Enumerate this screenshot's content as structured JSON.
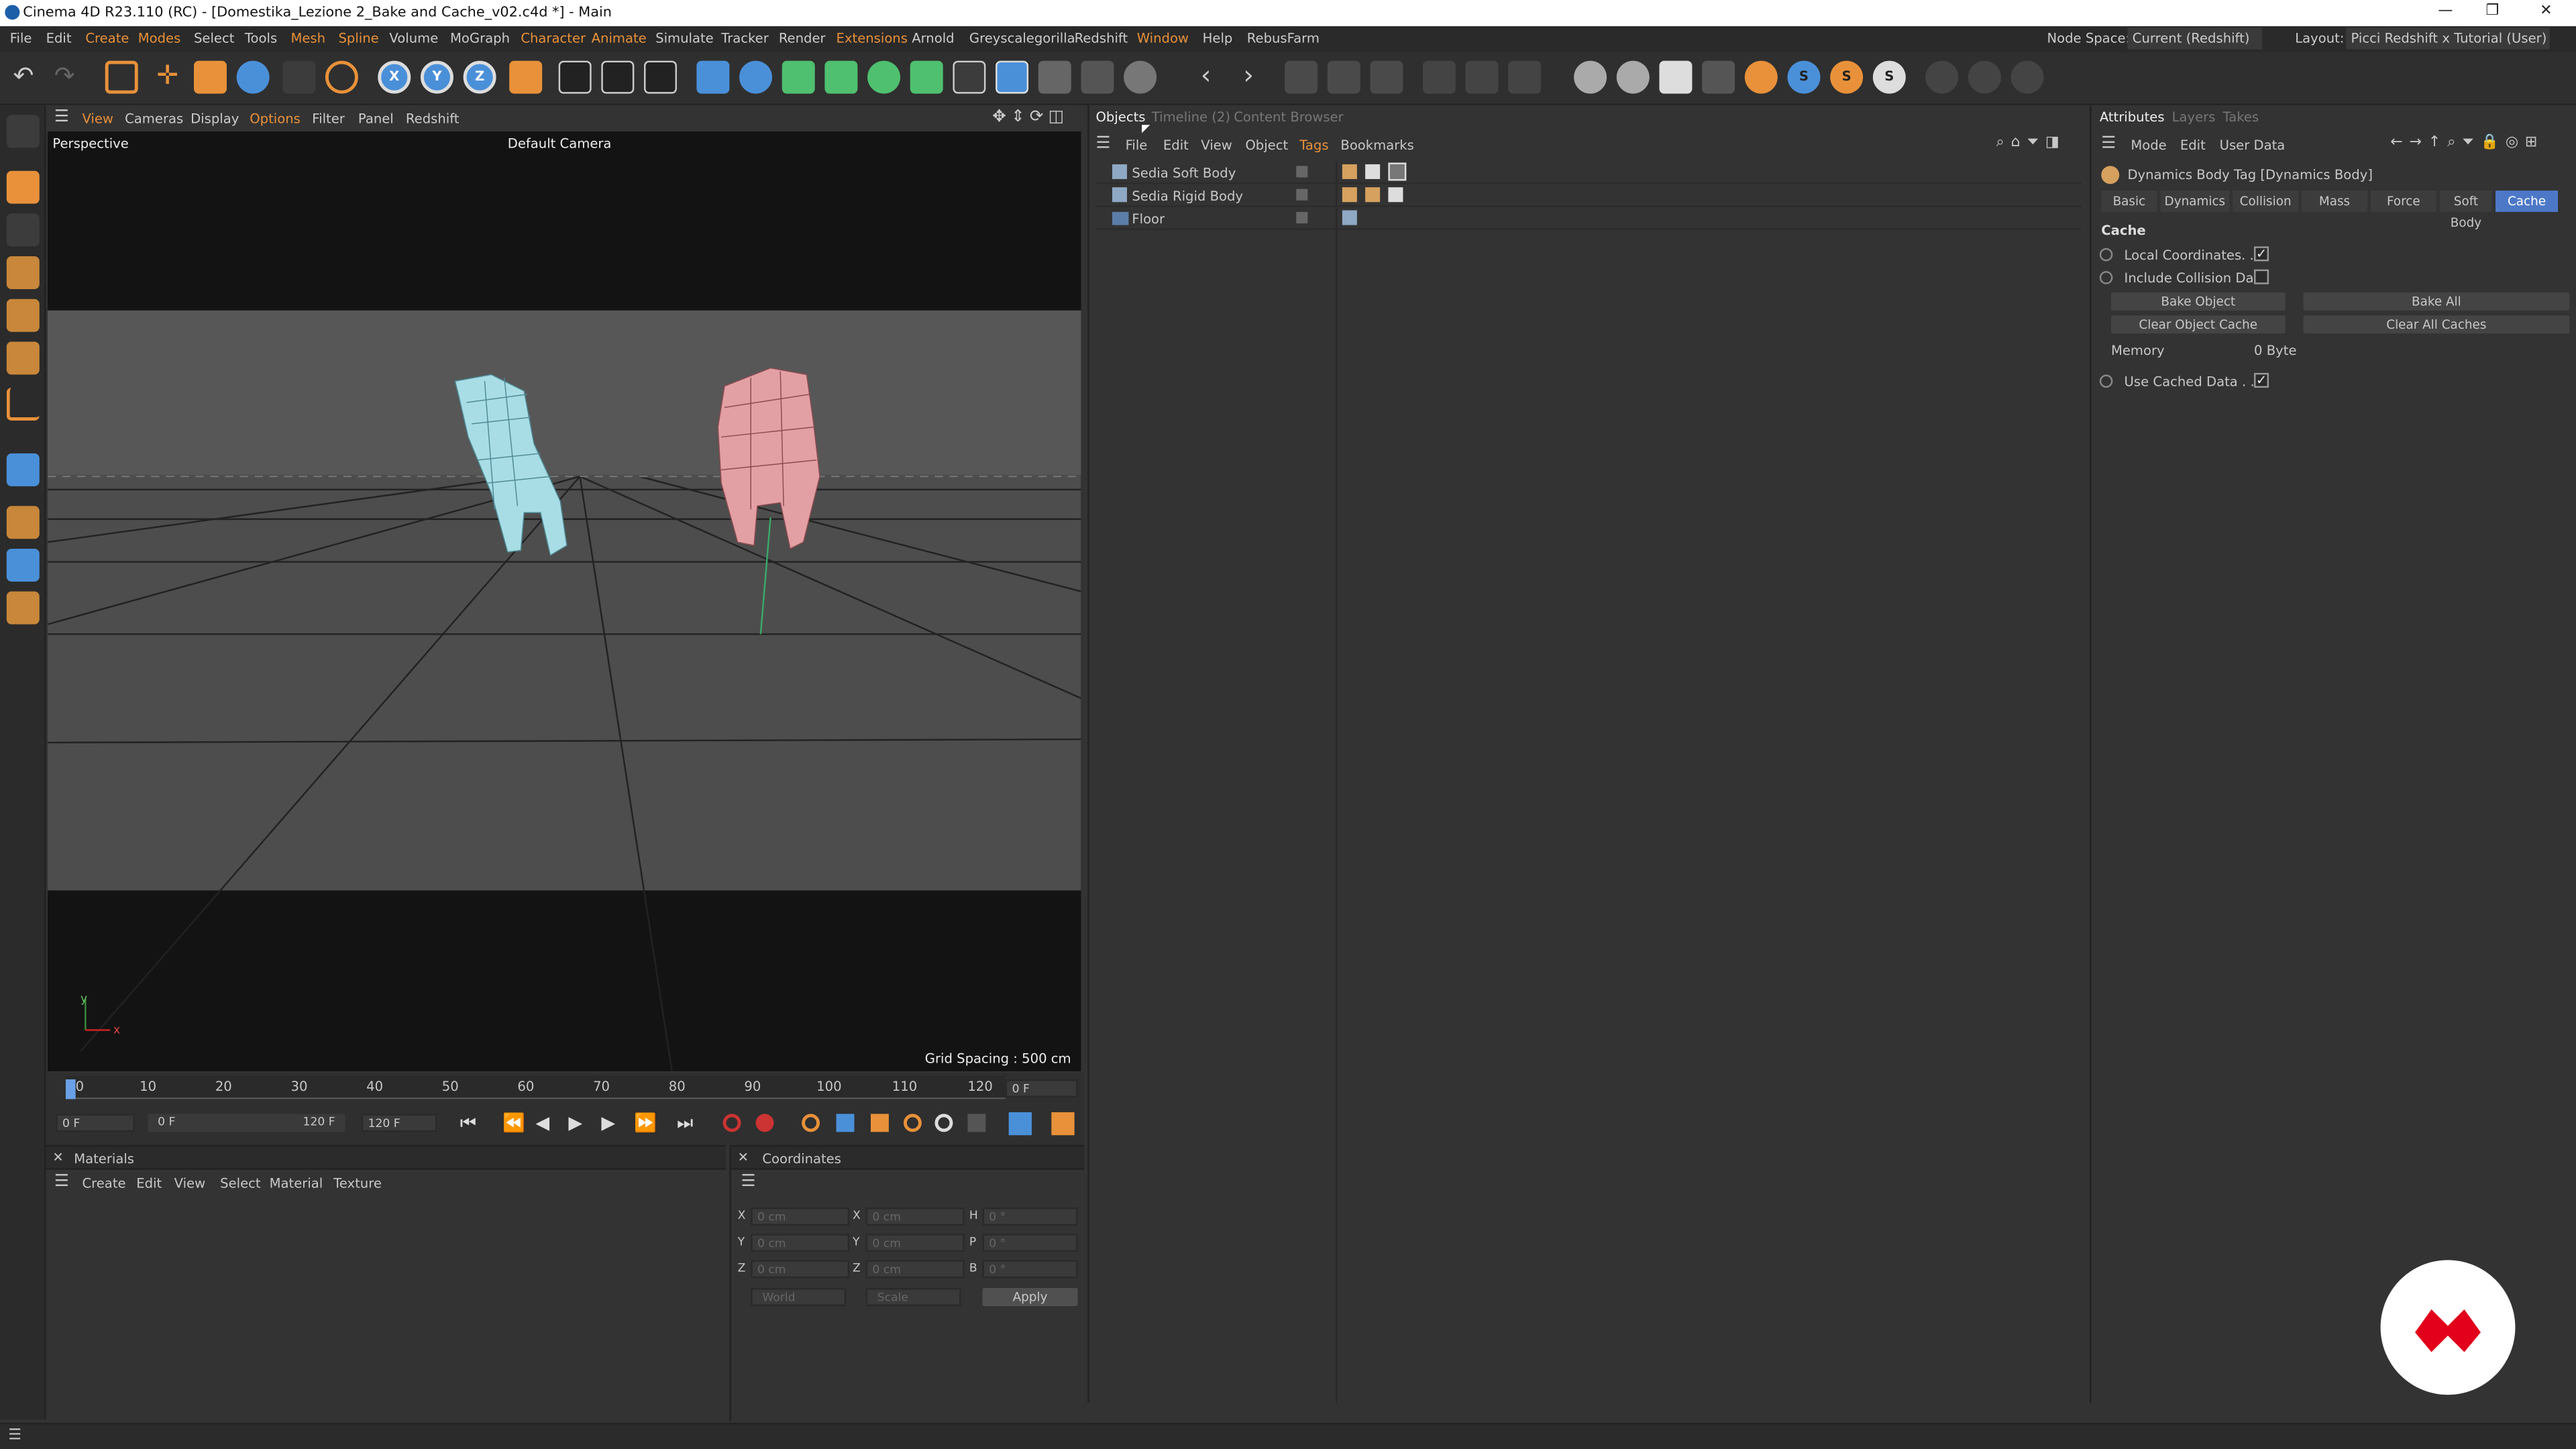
{
  "window": {
    "title": "Cinema 4D R23.110 (RC) - [Domestika_Lezione 2_Bake and Cache_v02.c4d *] - Main",
    "min": "—",
    "max": "❐",
    "close": "✕"
  },
  "menu": [
    "File",
    "Edit",
    "Create",
    "Modes",
    "Select",
    "Tools",
    "Mesh",
    "Spline",
    "Volume",
    "MoGraph",
    "Character",
    "Animate",
    "Simulate",
    "Tracker",
    "Render",
    "Extensions",
    "Arnold",
    "Greyscalegorilla",
    "Redshift",
    "Window",
    "Help",
    "RebusFarm"
  ],
  "node_space": {
    "label": "Node Space:",
    "value": "Current (Redshift)"
  },
  "layout": {
    "label": "Layout:",
    "value": "Picci Redshift x Tutorial (User)"
  },
  "viewport": {
    "menu": [
      "View",
      "Cameras",
      "Display",
      "Options",
      "Filter",
      "Panel",
      "Redshift"
    ],
    "view_name": "Perspective",
    "camera": "Default Camera",
    "grid_spacing": "Grid Spacing : 500 cm",
    "axis_x": "x",
    "axis_y": "y"
  },
  "timeline": {
    "ticks": [
      "0",
      "10",
      "20",
      "30",
      "40",
      "50",
      "60",
      "70",
      "80",
      "90",
      "100",
      "110",
      "120"
    ],
    "current_frame": "0 F",
    "start": "0 F",
    "range_start": "0 F",
    "range_end": "120 F",
    "end": "120 F"
  },
  "materials": {
    "title": "Materials",
    "menu": [
      "Create",
      "Edit",
      "View",
      "Select",
      "Material",
      "Texture"
    ]
  },
  "coordinates": {
    "title": "Coordinates",
    "rows": [
      {
        "a": "X",
        "av": "0 cm",
        "b": "X",
        "bv": "0 cm",
        "c": "H",
        "cv": "0 °"
      },
      {
        "a": "Y",
        "av": "0 cm",
        "b": "Y",
        "bv": "0 cm",
        "c": "P",
        "cv": "0 °"
      },
      {
        "a": "Z",
        "av": "0 cm",
        "b": "Z",
        "bv": "0 cm",
        "c": "B",
        "cv": "0 °"
      }
    ],
    "world": "World",
    "scale": "Scale",
    "apply": "Apply"
  },
  "objects": {
    "tabs": [
      "Objects",
      "Timeline (2)",
      "Content Browser"
    ],
    "menu": [
      "File",
      "Edit",
      "View",
      "Object",
      "Tags",
      "Bookmarks"
    ],
    "items": [
      "Sedia Soft Body",
      "Sedia Rigid Body",
      "Floor"
    ]
  },
  "attributes": {
    "tabs": [
      "Attributes",
      "Layers",
      "Takes"
    ],
    "menu": [
      "Mode",
      "Edit",
      "User Data"
    ],
    "header": "Dynamics Body Tag [Dynamics Body]",
    "subtabs": [
      "Basic",
      "Dynamics",
      "Collision",
      "Mass",
      "Force",
      "Soft Body",
      "Cache"
    ],
    "section": "Cache",
    "local_coords": "Local Coordinates. .",
    "include_collision": "Include Collision Data",
    "bake_object": "Bake Object",
    "bake_all": "Bake All",
    "clear_object": "Clear Object Cache",
    "clear_all": "Clear All Caches",
    "memory_label": "Memory",
    "memory_value": "0 Byte",
    "use_cached": "Use Cached Data . .",
    "check": "✓"
  },
  "colors": {
    "accent": "#4a90d9",
    "active_tab": "#4d78c8",
    "orange": "#e8913a",
    "logo": "#e2001a"
  }
}
